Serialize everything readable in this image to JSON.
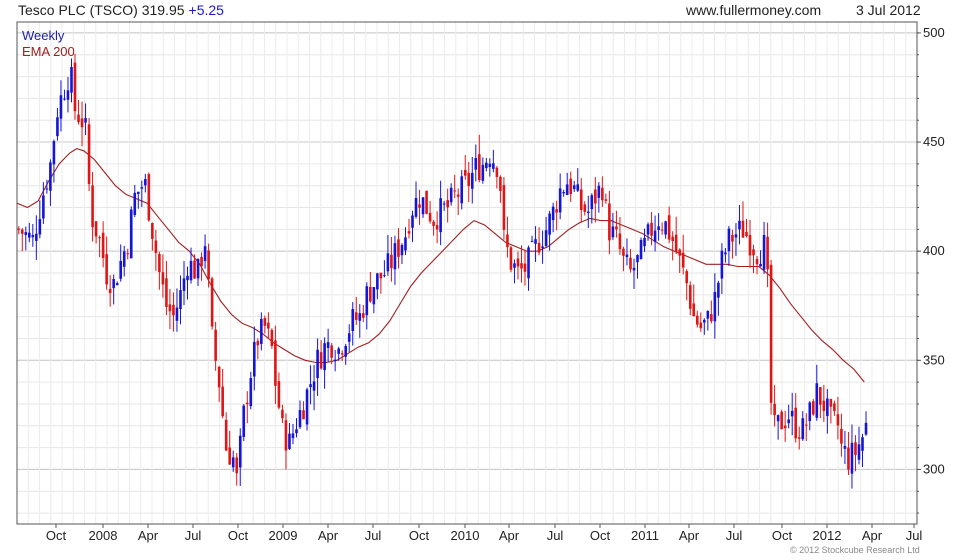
{
  "header": {
    "title": "Tesco PLC (TSCO) 319.95",
    "change": "+5.25",
    "site": "www.fullermoney.com",
    "date": "3 Jul 2012"
  },
  "legend": {
    "weekly": "Weekly",
    "ema": "EMA 200"
  },
  "copyright": "© 2012 Stockcube Research Ltd",
  "colors": {
    "up": "#1515d8",
    "down": "#e01515",
    "ema": "#a02020",
    "grid": "#d8d8d8"
  },
  "chart_data": {
    "type": "candlestick",
    "x_ticks": [
      "Oct",
      "2008",
      "Apr",
      "Jul",
      "Oct",
      "2009",
      "Apr",
      "Jul",
      "Oct",
      "2010",
      "Apr",
      "Jul",
      "Oct",
      "2011",
      "Apr",
      "Jul",
      "Oct",
      "2012",
      "Apr",
      "Jul"
    ],
    "y_ticks": [
      300,
      350,
      400,
      450,
      500
    ],
    "ylim": [
      275,
      505
    ],
    "x_range_weeks": [
      0,
      256
    ],
    "grid": true,
    "series": [
      {
        "name": "Weekly",
        "close_anchors": [
          [
            0,
            410
          ],
          [
            4,
            405
          ],
          [
            6,
            420
          ],
          [
            9,
            440
          ],
          [
            11,
            465
          ],
          [
            13,
            475
          ],
          [
            14,
            480
          ],
          [
            15,
            478
          ],
          [
            16,
            465
          ],
          [
            18,
            460
          ],
          [
            19,
            455
          ],
          [
            20,
            430
          ],
          [
            21,
            415
          ],
          [
            23,
            405
          ],
          [
            25,
            390
          ],
          [
            27,
            385
          ],
          [
            29,
            395
          ],
          [
            31,
            405
          ],
          [
            33,
            425
          ],
          [
            35,
            430
          ],
          [
            36,
            430
          ],
          [
            38,
            410
          ],
          [
            40,
            390
          ],
          [
            42,
            375
          ],
          [
            44,
            370
          ],
          [
            46,
            380
          ],
          [
            48,
            395
          ],
          [
            51,
            390
          ],
          [
            53,
            405
          ],
          [
            55,
            360
          ],
          [
            57,
            340
          ],
          [
            58,
            325
          ],
          [
            59,
            310
          ],
          [
            61,
            305
          ],
          [
            62,
            295
          ],
          [
            64,
            325
          ],
          [
            66,
            345
          ],
          [
            68,
            360
          ],
          [
            70,
            365
          ],
          [
            72,
            355
          ],
          [
            73,
            340
          ],
          [
            75,
            318
          ],
          [
            77,
            312
          ],
          [
            79,
            322
          ],
          [
            81,
            330
          ],
          [
            83,
            340
          ],
          [
            85,
            350
          ],
          [
            87,
            356
          ],
          [
            89,
            358
          ],
          [
            91,
            355
          ],
          [
            93,
            362
          ],
          [
            95,
            368
          ],
          [
            97,
            370
          ],
          [
            99,
            380
          ],
          [
            101,
            385
          ],
          [
            104,
            390
          ],
          [
            106,
            395
          ],
          [
            108,
            402
          ],
          [
            110,
            408
          ],
          [
            111,
            415
          ],
          [
            112,
            420
          ],
          [
            114,
            425
          ],
          [
            116,
            420
          ],
          [
            118,
            415
          ],
          [
            120,
            418
          ],
          [
            122,
            420
          ],
          [
            124,
            425
          ],
          [
            126,
            428
          ],
          [
            128,
            432
          ],
          [
            130,
            438
          ],
          [
            132,
            440
          ],
          [
            134,
            445
          ],
          [
            136,
            440
          ],
          [
            137,
            430
          ],
          [
            138,
            405
          ],
          [
            140,
            395
          ],
          [
            142,
            390
          ],
          [
            144,
            392
          ],
          [
            146,
            398
          ],
          [
            148,
            405
          ],
          [
            150,
            410
          ],
          [
            152,
            418
          ],
          [
            154,
            428
          ],
          [
            156,
            432
          ],
          [
            158,
            428
          ],
          [
            160,
            420
          ],
          [
            162,
            418
          ],
          [
            164,
            425
          ],
          [
            166,
            430
          ],
          [
            167,
            418
          ],
          [
            168,
            410
          ],
          [
            170,
            405
          ],
          [
            172,
            395
          ],
          [
            174,
            390
          ],
          [
            176,
            395
          ],
          [
            178,
            402
          ],
          [
            180,
            410
          ],
          [
            182,
            415
          ],
          [
            184,
            412
          ],
          [
            186,
            405
          ],
          [
            188,
            395
          ],
          [
            190,
            385
          ],
          [
            192,
            370
          ],
          [
            194,
            365
          ],
          [
            196,
            368
          ],
          [
            198,
            378
          ],
          [
            200,
            395
          ],
          [
            202,
            405
          ],
          [
            204,
            408
          ],
          [
            206,
            410
          ],
          [
            208,
            405
          ],
          [
            210,
            400
          ],
          [
            212,
            402
          ],
          [
            213,
            385
          ],
          [
            214,
            330
          ],
          [
            215,
            318
          ],
          [
            217,
            322
          ],
          [
            219,
            325
          ],
          [
            221,
            320
          ],
          [
            223,
            318
          ],
          [
            225,
            325
          ],
          [
            227,
            335
          ],
          [
            229,
            330
          ],
          [
            231,
            322
          ],
          [
            233,
            320
          ],
          [
            234,
            310
          ],
          [
            236,
            305
          ],
          [
            238,
            308
          ],
          [
            240,
            315
          ],
          [
            241,
            320
          ]
        ]
      },
      {
        "name": "EMA 200",
        "values": [
          [
            0,
            422
          ],
          [
            3,
            420
          ],
          [
            6,
            423
          ],
          [
            9,
            432
          ],
          [
            12,
            440
          ],
          [
            15,
            445
          ],
          [
            17,
            447
          ],
          [
            19,
            446
          ],
          [
            22,
            442
          ],
          [
            25,
            436
          ],
          [
            28,
            430
          ],
          [
            31,
            426
          ],
          [
            34,
            424
          ],
          [
            37,
            422
          ],
          [
            40,
            416
          ],
          [
            43,
            410
          ],
          [
            46,
            404
          ],
          [
            49,
            400
          ],
          [
            52,
            394
          ],
          [
            55,
            385
          ],
          [
            58,
            377
          ],
          [
            61,
            371
          ],
          [
            64,
            367
          ],
          [
            67,
            365
          ],
          [
            70,
            362
          ],
          [
            73,
            358
          ],
          [
            76,
            355
          ],
          [
            79,
            352
          ],
          [
            82,
            350
          ],
          [
            85,
            349
          ],
          [
            88,
            349
          ],
          [
            91,
            350
          ],
          [
            94,
            353
          ],
          [
            97,
            356
          ],
          [
            100,
            358
          ],
          [
            103,
            362
          ],
          [
            106,
            368
          ],
          [
            109,
            376
          ],
          [
            112,
            384
          ],
          [
            115,
            390
          ],
          [
            118,
            395
          ],
          [
            121,
            400
          ],
          [
            124,
            405
          ],
          [
            127,
            410
          ],
          [
            130,
            414
          ],
          [
            133,
            412
          ],
          [
            136,
            408
          ],
          [
            139,
            404
          ],
          [
            142,
            402
          ],
          [
            145,
            400
          ],
          [
            148,
            400
          ],
          [
            151,
            402
          ],
          [
            154,
            406
          ],
          [
            157,
            410
          ],
          [
            160,
            413
          ],
          [
            163,
            415
          ],
          [
            166,
            414
          ],
          [
            169,
            414
          ],
          [
            172,
            412
          ],
          [
            175,
            410
          ],
          [
            178,
            408
          ],
          [
            181,
            405
          ],
          [
            184,
            402
          ],
          [
            187,
            400
          ],
          [
            190,
            398
          ],
          [
            193,
            396
          ],
          [
            196,
            394
          ],
          [
            199,
            394
          ],
          [
            202,
            394
          ],
          [
            205,
            393
          ],
          [
            208,
            393
          ],
          [
            211,
            393
          ],
          [
            214,
            389
          ],
          [
            217,
            383
          ],
          [
            220,
            376
          ],
          [
            223,
            370
          ],
          [
            226,
            364
          ],
          [
            229,
            359
          ],
          [
            232,
            355
          ],
          [
            235,
            350
          ],
          [
            238,
            346
          ],
          [
            241,
            340
          ]
        ]
      }
    ]
  }
}
